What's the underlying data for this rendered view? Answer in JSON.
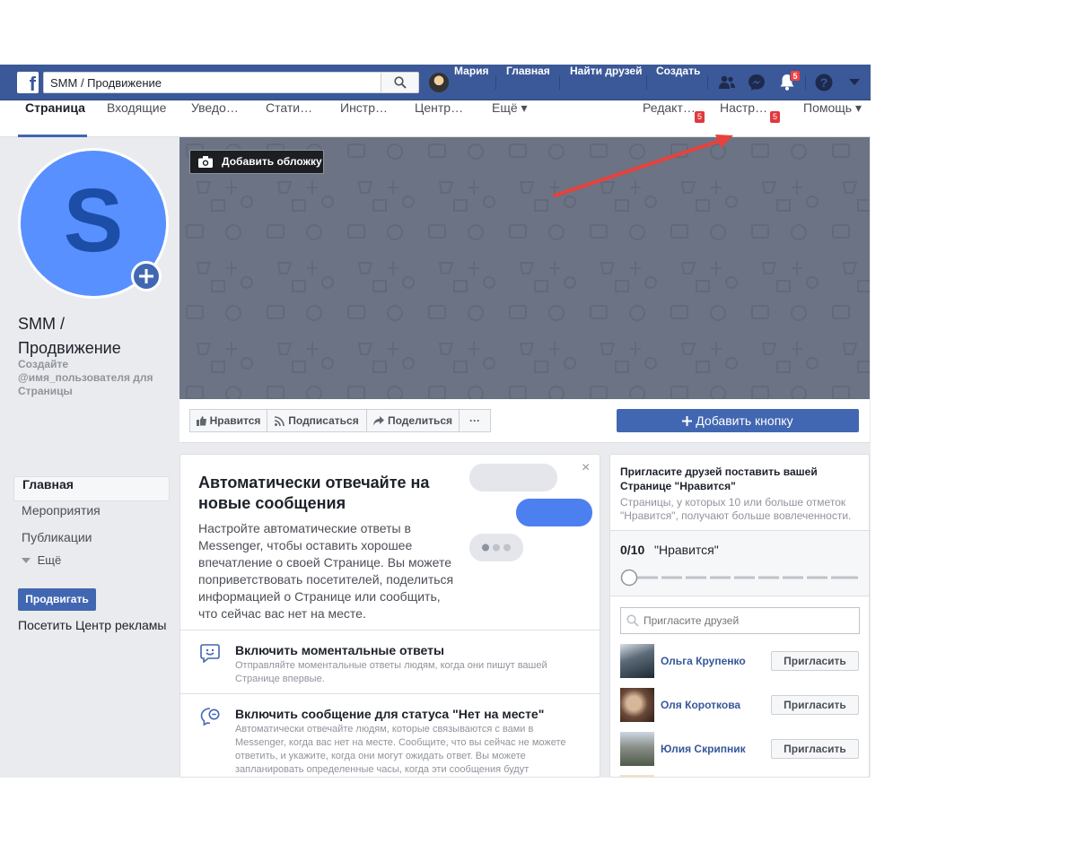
{
  "topbar": {
    "search_value": "SMM / Продвижение",
    "user_name": "Мария",
    "nav": [
      "Главная",
      "Найти друзей",
      "Создать"
    ],
    "notifications_count": "5"
  },
  "page_tabs": {
    "items": [
      "Страница",
      "Входящие",
      "Уведо…",
      "Стати…",
      "Инстр…",
      "Центр…",
      "Ещё ▾"
    ],
    "right": [
      "Редакт…",
      "Настр…",
      "Помощь ▾"
    ],
    "edit_badge": "5",
    "settings_badge": "5"
  },
  "profile": {
    "letter": "S",
    "name": "SMM / Продвижение",
    "username_hint": "Создайте @имя_пользователя для Страницы"
  },
  "left_nav": {
    "items": [
      "Главная",
      "Мероприятия",
      "Публикации"
    ],
    "more": "Ещё",
    "promote": "Продвигать",
    "ads_center": "Посетить Центр рекламы"
  },
  "cover": {
    "add_cover": "Добавить обложку"
  },
  "actions": {
    "like": "Нравится",
    "follow": "Подписаться",
    "share": "Поделиться",
    "more": "···",
    "add_button": "Добавить кнопку"
  },
  "promo": {
    "close": "×",
    "title": "Автоматически отвечайте на новые сообщения",
    "text": "Настройте автоматические ответы в Messenger, чтобы оставить хорошее впечатление о своей Странице. Вы можете поприветствовать посетителей, поделиться информацией о Странице или сообщить, что сейчас вас нет на месте.",
    "rows": [
      {
        "title": "Включить моментальные ответы",
        "desc": "Отправляйте моментальные ответы людям, когда они пишут вашей Странице впервые."
      },
      {
        "title": "Включить сообщение для статуса \"Нет на месте\"",
        "desc": "Автоматически отвечайте людям, которые связываются с вами в Messenger, когда вас нет на месте. Сообщите, что вы сейчас не можете ответить, и укажите, когда они могут ожидать ответ. Вы можете запланировать определенные часы, когда эти сообщения будут"
      }
    ]
  },
  "invite": {
    "title": "Пригласите друзей поставить вашей Странице \"Нравится\"",
    "desc": "Страницы, у которых 10 или больше отметок \"Нравится\", получают больше вовлеченности.",
    "count": "0/10",
    "count_label": "\"Нравится\"",
    "progress_value": 0,
    "search_placeholder": "Пригласите друзей",
    "invite_label": "Пригласить",
    "friends": [
      "Ольга Крупенко",
      "Оля Короткова",
      "Юлия Скрипник"
    ]
  },
  "colors": {
    "brand": "#3b5998",
    "primary_button": "#4267b2",
    "cover": "#6b7384",
    "annotation_arrow": "#e8413c",
    "badge": "#e0393e"
  }
}
